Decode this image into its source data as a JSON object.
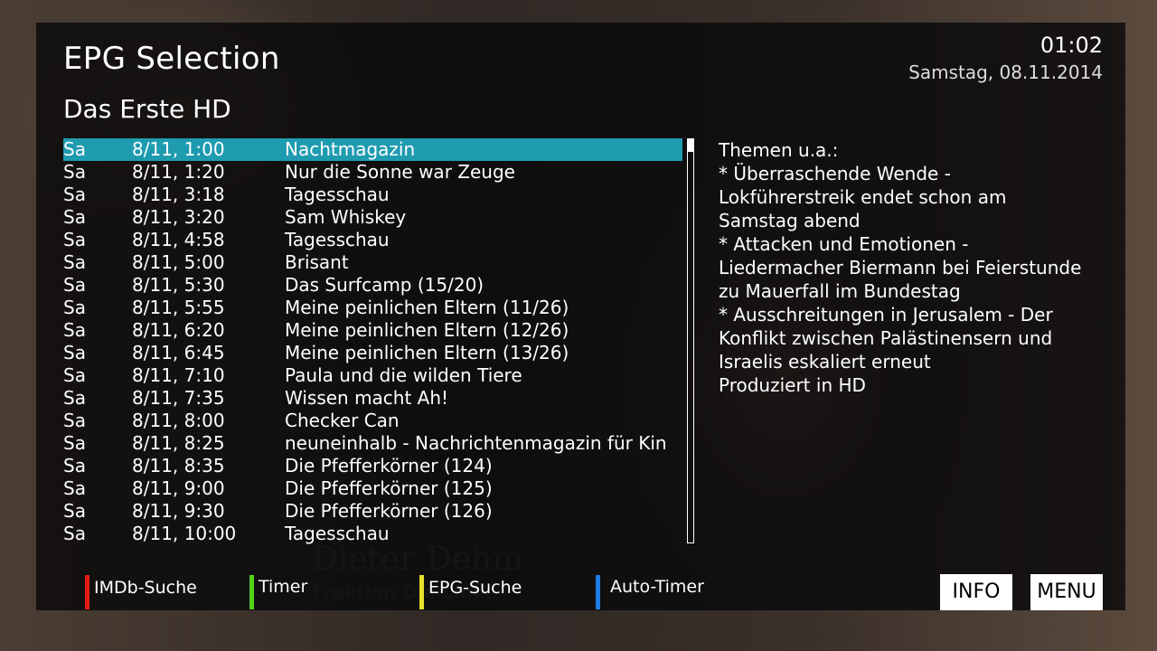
{
  "header": {
    "title": "EPG Selection",
    "channel": "Das Erste HD",
    "time": "01:02",
    "date": "Samstag, 08.11.2014"
  },
  "epg_list": [
    {
      "day": "Sa",
      "time": "8/11, 1:00",
      "title": "Nachtmagazin",
      "selected": true
    },
    {
      "day": "Sa",
      "time": "8/11, 1:20",
      "title": "Nur die Sonne war Zeuge"
    },
    {
      "day": "Sa",
      "time": "8/11, 3:18",
      "title": "Tagesschau"
    },
    {
      "day": "Sa",
      "time": "8/11, 3:20",
      "title": "Sam Whiskey"
    },
    {
      "day": "Sa",
      "time": "8/11, 4:58",
      "title": "Tagesschau"
    },
    {
      "day": "Sa",
      "time": "8/11, 5:00",
      "title": "Brisant"
    },
    {
      "day": "Sa",
      "time": "8/11, 5:30",
      "title": "Das Surfcamp (15/20)"
    },
    {
      "day": "Sa",
      "time": "8/11, 5:55",
      "title": "Meine peinlichen Eltern (11/26)"
    },
    {
      "day": "Sa",
      "time": "8/11, 6:20",
      "title": "Meine peinlichen Eltern (12/26)"
    },
    {
      "day": "Sa",
      "time": "8/11, 6:45",
      "title": "Meine peinlichen Eltern (13/26)"
    },
    {
      "day": "Sa",
      "time": "8/11, 7:10",
      "title": "Paula und die wilden Tiere"
    },
    {
      "day": "Sa",
      "time": "8/11, 7:35",
      "title": "Wissen macht Ah!"
    },
    {
      "day": "Sa",
      "time": "8/11, 8:00",
      "title": "Checker Can"
    },
    {
      "day": "Sa",
      "time": "8/11, 8:25",
      "title": "neuneinhalb - Nachrichtenmagazin für Kin"
    },
    {
      "day": "Sa",
      "time": "8/11, 8:35",
      "title": "Die Pfefferkörner (124)"
    },
    {
      "day": "Sa",
      "time": "8/11, 9:00",
      "title": "Die Pfefferkörner (125)"
    },
    {
      "day": "Sa",
      "time": "8/11, 9:30",
      "title": "Die Pfefferkörner (126)"
    },
    {
      "day": "Sa",
      "time": "8/11, 10:00",
      "title": "Tagesschau"
    }
  ],
  "description": {
    "lines": [
      "Themen u.a.:",
      "* Überraschende Wende -",
      "Lokführerstreik endet schon am",
      "Samstag abend",
      "* Attacken und Emotionen -",
      "Liedermacher Biermann bei Feierstunde",
      "zu Mauerfall im Bundestag",
      "* Ausschreitungen in Jerusalem - Der",
      "Konflikt zwischen Palästinensern und",
      "Israelis eskaliert erneut",
      "Produziert in HD"
    ]
  },
  "footer": {
    "red": {
      "label": "IMDb-Suche",
      "color": "#e41b13"
    },
    "green": {
      "label": "Timer",
      "color": "#4fd317"
    },
    "yellow": {
      "label": "EPG-Suche",
      "color": "#e6e12a"
    },
    "blue": {
      "label": "Auto-Timer",
      "color": "#1b7de4"
    },
    "info_key": "INFO",
    "menu_key": "MENU"
  }
}
